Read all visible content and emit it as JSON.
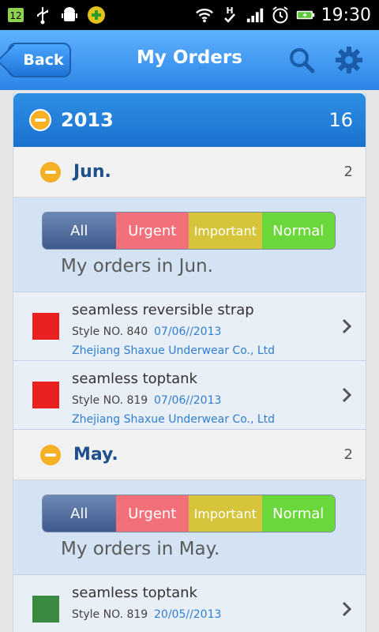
{
  "status_bar": {
    "time": "19:30",
    "left_icons": [
      "sim-12-icon",
      "usb-icon",
      "android-debug-icon",
      "plus-badge-icon"
    ],
    "right_icons": [
      "wifi-icon",
      "hsdpa-icon",
      "signal-icon",
      "alarm-icon",
      "battery-charging-icon"
    ]
  },
  "header": {
    "back_label": "Back",
    "title": "My Orders",
    "icons": [
      "search-icon",
      "gear-icon"
    ],
    "colors": {
      "bar_top": "#5fb0ff",
      "bar_bottom": "#2c86e6"
    }
  },
  "year_group": {
    "label": "2013",
    "count": "16"
  },
  "filter_labels": {
    "all": "All",
    "urgent": "Urgent",
    "important": "Important",
    "normal": "Normal"
  },
  "months": [
    {
      "label": "Jun.",
      "count": "2",
      "title": "My orders in Jun.",
      "orders": [
        {
          "name": "seamless reversible strap",
          "style": "Style NO. 840",
          "date": "07/06//2013",
          "company": "Zhejiang Shaxue Underwear Co., Ltd",
          "color": "#e82020"
        },
        {
          "name": "seamless toptank",
          "style": "Style NO. 819",
          "date": "07/06//2013",
          "company": "Zhejiang Shaxue Underwear Co., Ltd",
          "color": "#e82020"
        }
      ]
    },
    {
      "label": "May.",
      "count": "2",
      "title": "My orders in May.",
      "orders": [
        {
          "name": "seamless toptank",
          "style": "Style NO. 819",
          "date": "20/05//2013",
          "company": "",
          "color": "#3a8a42"
        }
      ]
    }
  ]
}
